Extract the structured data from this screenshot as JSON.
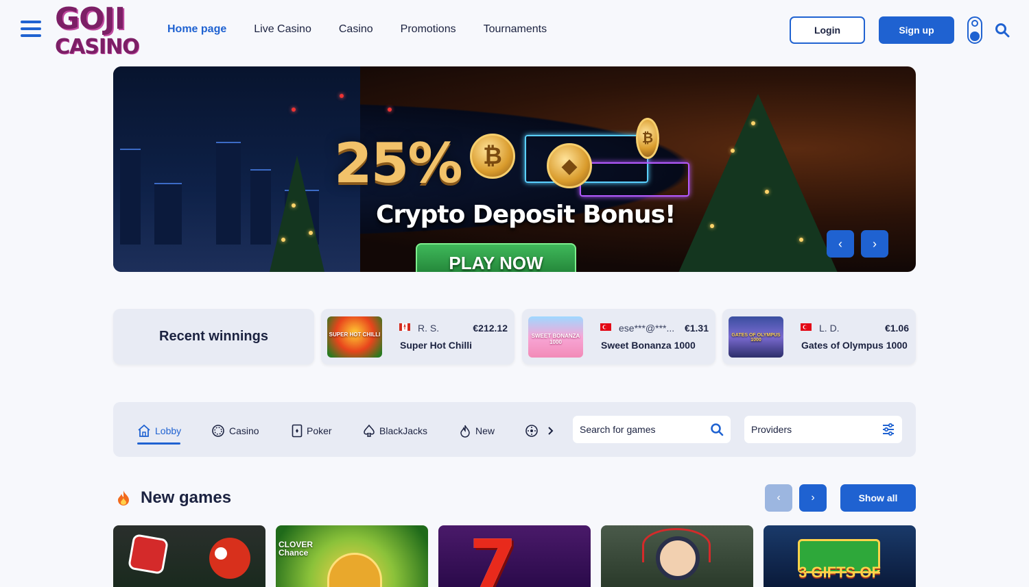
{
  "header": {
    "logo_line1": "GOJI",
    "logo_line2": "CASINO",
    "nav": [
      {
        "label": "Home page",
        "active": true
      },
      {
        "label": "Live Casino",
        "active": false
      },
      {
        "label": "Casino",
        "active": false
      },
      {
        "label": "Promotions",
        "active": false
      },
      {
        "label": "Tournaments",
        "active": false
      }
    ],
    "login_label": "Login",
    "signup_label": "Sign up"
  },
  "banner": {
    "percent": "25%",
    "headline": "Crypto Deposit Bonus!",
    "cta": "PLAY NOW",
    "prev_icon": "‹",
    "next_icon": "›"
  },
  "recent_winnings": {
    "title": "Recent winnings",
    "items": [
      {
        "user": "R. S.",
        "amount": "€212.12",
        "game": "Super Hot Chilli",
        "flag": "canada-flag",
        "thumb_text": "SUPER HOT CHILLI"
      },
      {
        "user": "ese***@***...",
        "amount": "€1.31",
        "game": "Sweet Bonanza 1000",
        "flag": "turkey-flag",
        "thumb_text": "SWEET BONANZA 1000"
      },
      {
        "user": "L. D.",
        "amount": "€1.06",
        "game": "Gates of Olympus 1000",
        "flag": "turkey-flag",
        "thumb_text": "GATES OF OLYMPUS 1000"
      }
    ]
  },
  "categories": {
    "items": [
      {
        "label": "Lobby",
        "icon": "home-icon",
        "active": true
      },
      {
        "label": "Casino",
        "icon": "casino-chip-icon",
        "active": false
      },
      {
        "label": "Poker",
        "icon": "poker-card-icon",
        "active": false
      },
      {
        "label": "BlackJacks",
        "icon": "spade-icon",
        "active": false
      },
      {
        "label": "New",
        "icon": "flame-icon",
        "active": false
      }
    ],
    "search_placeholder": "Search for games",
    "providers_label": "Providers"
  },
  "new_games": {
    "title": "New games",
    "show_all_label": "Show all",
    "prev_icon": "‹",
    "next_icon": "›",
    "tiles": [
      {
        "name": "chicken-road-tile",
        "caption": ""
      },
      {
        "name": "clover-chance-tile",
        "caption": "CLOVER Chance"
      },
      {
        "name": "lucky-seven-tile",
        "caption": ""
      },
      {
        "name": "ninja-girl-tile",
        "caption": ""
      },
      {
        "name": "3-gifts-tile",
        "caption": "3 GIFTS OF"
      }
    ]
  },
  "colors": {
    "brand_blue": "#1f62d1",
    "logo_purple": "#7c1f66",
    "page_bg": "#f7f8fc",
    "card_bg": "#e8ebf4"
  }
}
